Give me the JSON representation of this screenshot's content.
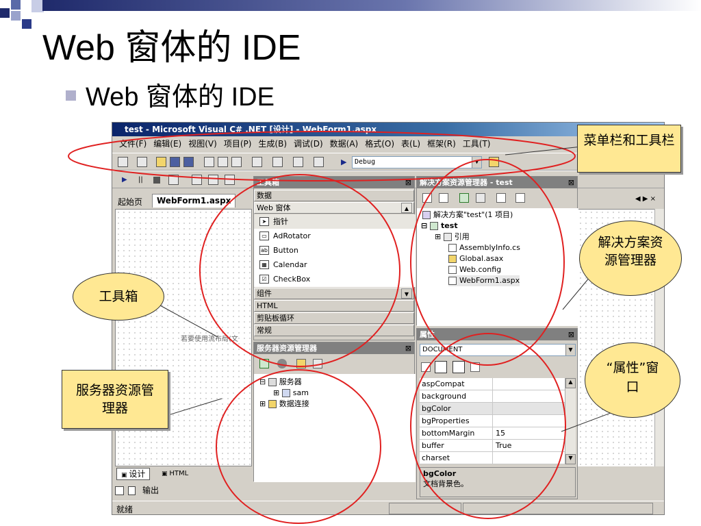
{
  "slide": {
    "title": "Web 窗体的 IDE",
    "bullet": "Web 窗体的 IDE"
  },
  "ide": {
    "window_title": "test - Microsoft Visual C# .NET [设计] - WebForm1.aspx",
    "menu": [
      "文件(F)",
      "编辑(E)",
      "视图(V)",
      "项目(P)",
      "生成(B)",
      "调试(D)",
      "数据(A)",
      "格式(O)",
      "表(L)",
      "框架(R)",
      "工具(T)"
    ],
    "config": "Debug",
    "tabs": [
      "起始页",
      "WebForm1.aspx"
    ],
    "designer_hint": "若要使用流布局(文",
    "bottom_tabs": [
      "设计",
      "HTML"
    ],
    "output_label": "输出",
    "status": "就绪",
    "toolbox": {
      "title": "工具箱",
      "categories_top": [
        "数据",
        "Web 窗体"
      ],
      "items": [
        "指针",
        "AdRotator",
        "Button",
        "Calendar",
        "CheckBox"
      ],
      "categories_bottom": [
        "组件",
        "HTML",
        "剪贴板循环",
        "常规"
      ]
    },
    "server_explorer": {
      "title": "服务器资源管理器",
      "nodes": [
        "服务器",
        "sam",
        "数据连接"
      ]
    },
    "solution": {
      "title": "解决方案资源管理器 - test",
      "nodes": [
        "解决方案\"test\"(1 项目)",
        "test",
        "引用",
        "AssemblyInfo.cs",
        "Global.asax",
        "Web.config",
        "WebForm1.aspx"
      ]
    },
    "properties": {
      "title": "属性",
      "object": "DOCUMENT",
      "rows": [
        {
          "name": "aspCompat",
          "value": ""
        },
        {
          "name": "background",
          "value": ""
        },
        {
          "name": "bgColor",
          "value": ""
        },
        {
          "name": "bgProperties",
          "value": ""
        },
        {
          "name": "bottomMargin",
          "value": "15"
        },
        {
          "name": "buffer",
          "value": "True"
        },
        {
          "name": "charset",
          "value": ""
        }
      ],
      "desc_name": "bgColor",
      "desc_text": "文档背景色。"
    }
  },
  "callouts": {
    "menubar": "菜单栏和工具栏",
    "solution": "解决方案资源管理器",
    "toolbox": "工具箱",
    "properties": "“属性”窗口",
    "server": "服务器资源管理器"
  },
  "colors": {
    "title_bar": "#0a246a",
    "callout": "#ffe893",
    "circle": "#e02020",
    "panel": "#d4d0c8"
  }
}
